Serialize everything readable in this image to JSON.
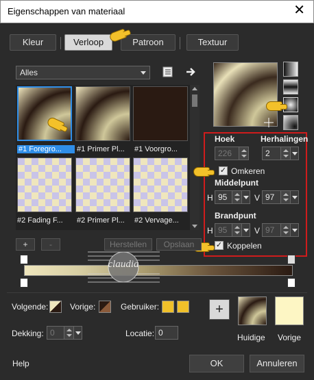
{
  "window": {
    "title": "Eigenschappen van materiaal",
    "close_glyph": "✕"
  },
  "tabs": [
    {
      "label": "Kleur"
    },
    {
      "label": "Verloop",
      "active": true
    },
    {
      "label": "Patroon"
    },
    {
      "label": "Textuur"
    }
  ],
  "library": {
    "category": "Alles",
    "items": [
      {
        "label": "#1 Foregro..."
      },
      {
        "label": "#1 Primer Pl..."
      },
      {
        "label": "#1 Voorgro..."
      },
      {
        "label": "#2 Fading F..."
      },
      {
        "label": "#2 Primer Pl..."
      },
      {
        "label": "#2 Vervage..."
      }
    ],
    "add_label": "+",
    "remove_label": "-"
  },
  "gradient": {
    "hoek_label": "Hoek",
    "hoek_value": "226",
    "herhalingen_label": "Herhalingen",
    "herhalingen_value": "2",
    "omkeren_label": "Omkeren",
    "omkeren_checked": true,
    "middelpunt_label": "Middelpunt",
    "middelpunt_h_label": "H",
    "middelpunt_h_value": "95",
    "middelpunt_v_label": "V",
    "middelpunt_v_value": "97",
    "brandpunt_label": "Brandpunt",
    "brandpunt_h_label": "H",
    "brandpunt_h_value": "95",
    "brandpunt_v_label": "V",
    "brandpunt_v_value": "97",
    "koppelen_label": "Koppelen",
    "koppelen_checked": true
  },
  "editor": {
    "hidden_btn1": "Herstellen",
    "hidden_btn2": "Opslaan",
    "watermark": "claudia"
  },
  "bottom": {
    "volgende_label": "Volgende:",
    "vorige_label": "Vorige:",
    "gebruiker_label": "Gebruiker:",
    "dekking_label": "Dekking:",
    "dekking_value": "0",
    "locatie_label": "Locatie:",
    "locatie_value": "0",
    "plus_label": "+",
    "huidige_label": "Huidige",
    "vorige2_label": "Vorige",
    "colors": {
      "gold": "#f0c02a",
      "cream": "#fdf6c4",
      "dark": "#2a1a12",
      "light": "#efe6bd"
    }
  },
  "footer": {
    "help": "Help",
    "ok": "OK",
    "cancel": "Annuleren"
  }
}
